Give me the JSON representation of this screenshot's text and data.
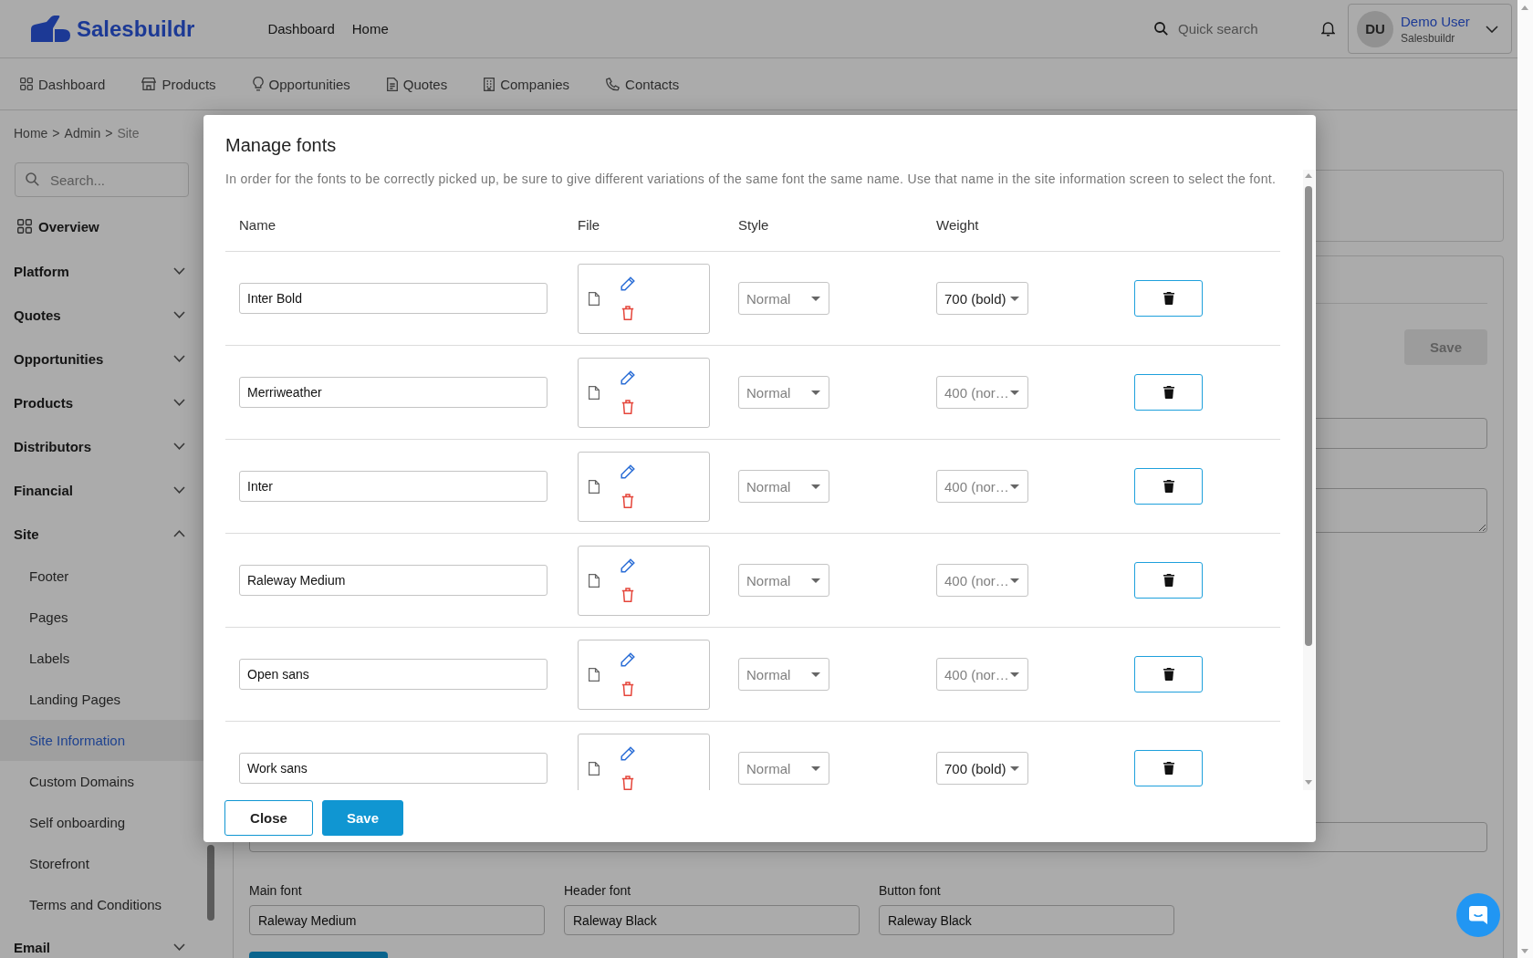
{
  "topbar": {
    "logo": "Salesbuildr",
    "nav": [
      {
        "label": "Dashboard"
      },
      {
        "label": "Home"
      }
    ],
    "search": {
      "placeholder": "Quick search"
    },
    "user": {
      "initials": "DU",
      "name": "Demo User",
      "organization": "Salesbuildr"
    }
  },
  "module_nav": [
    {
      "label": "Dashboard"
    },
    {
      "label": "Products"
    },
    {
      "label": "Opportunities"
    },
    {
      "label": "Quotes"
    },
    {
      "label": "Companies"
    },
    {
      "label": "Contacts"
    }
  ],
  "sidebar": {
    "breadcrumb": [
      {
        "kind": "link",
        "text": "Home"
      },
      {
        "kind": "separator",
        "text": ">"
      },
      {
        "kind": "link",
        "text": "Admin"
      },
      {
        "kind": "separator",
        "text": ">"
      },
      {
        "kind": "current",
        "text": "Site"
      }
    ],
    "search": {
      "placeholder": "Search..."
    },
    "overview": {
      "label": "Overview"
    },
    "sections": [
      {
        "label": "Platform",
        "expanded": false
      },
      {
        "label": "Quotes",
        "expanded": false
      },
      {
        "label": "Opportunities",
        "expanded": false
      },
      {
        "label": "Products",
        "expanded": false
      },
      {
        "label": "Distributors",
        "expanded": false
      },
      {
        "label": "Financial",
        "expanded": false
      },
      {
        "label": "Site",
        "expanded": true,
        "children": [
          {
            "label": "Footer",
            "selected": false
          },
          {
            "label": "Pages",
            "selected": false
          },
          {
            "label": "Labels",
            "selected": false
          },
          {
            "label": "Landing Pages",
            "selected": false
          },
          {
            "label": "Site Information",
            "selected": true
          },
          {
            "label": "Custom Domains",
            "selected": false
          },
          {
            "label": "Self onboarding",
            "selected": false
          },
          {
            "label": "Storefront",
            "selected": false
          },
          {
            "label": "Terms and Conditions",
            "selected": false
          }
        ]
      },
      {
        "label": "Email",
        "expanded": false
      }
    ]
  },
  "page": {
    "save_button": {
      "label": "Save",
      "disabled": true
    },
    "font_fields": [
      {
        "label": "Main font",
        "value": "Raleway Medium"
      },
      {
        "label": "Header font",
        "value": "Raleway Black"
      },
      {
        "label": "Button font",
        "value": "Raleway Black"
      }
    ]
  },
  "modal": {
    "title": "Manage fonts",
    "description": "In order for the fonts to be correctly picked up, be sure to give different variations of the same font the same name. Use that name in the site information screen to select the font.",
    "columns": [
      "Name",
      "File",
      "Style",
      "Weight"
    ],
    "rows": [
      {
        "name": "Inter Bold",
        "style": {
          "placeholder": "Normal"
        },
        "weight": {
          "value": "700 (bold)"
        }
      },
      {
        "name": "Merriweather",
        "style": {
          "placeholder": "Normal"
        },
        "weight": {
          "placeholder": "400 (nor…"
        }
      },
      {
        "name": "Inter",
        "style": {
          "placeholder": "Normal"
        },
        "weight": {
          "placeholder": "400 (nor…"
        }
      },
      {
        "name": "Raleway Medium",
        "style": {
          "placeholder": "Normal"
        },
        "weight": {
          "placeholder": "400 (nor…"
        }
      },
      {
        "name": "Open sans",
        "style": {
          "placeholder": "Normal"
        },
        "weight": {
          "placeholder": "400 (nor…"
        }
      },
      {
        "name": "Work sans",
        "style": {
          "placeholder": "Normal"
        },
        "weight": {
          "value": "700 (bold)"
        }
      }
    ],
    "buttons": [
      {
        "label": "Close",
        "kind": "secondary"
      },
      {
        "label": "Save",
        "kind": "primary"
      }
    ]
  }
}
